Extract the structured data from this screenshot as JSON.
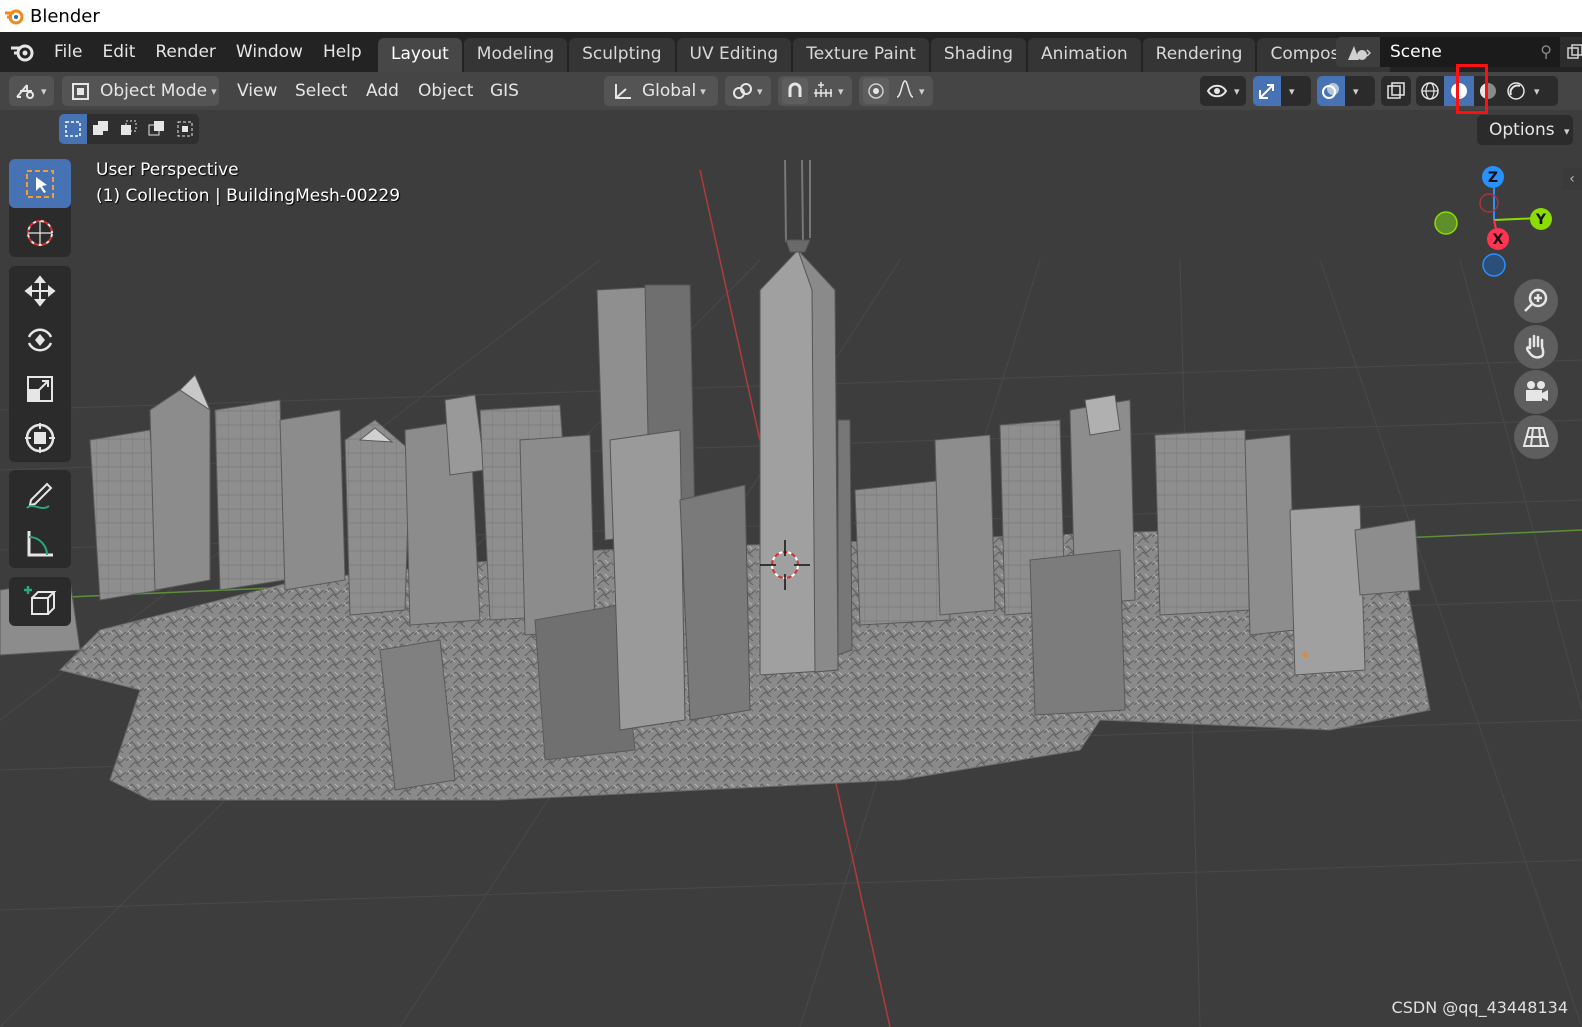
{
  "window": {
    "title": "Blender"
  },
  "menubar": {
    "items": [
      "File",
      "Edit",
      "Render",
      "Window",
      "Help"
    ]
  },
  "workspaces": {
    "tabs": [
      "Layout",
      "Modeling",
      "Sculpting",
      "UV Editing",
      "Texture Paint",
      "Shading",
      "Animation",
      "Rendering",
      "Compositing"
    ],
    "active": "Layout"
  },
  "scene": {
    "name": "Scene"
  },
  "viewport_header": {
    "mode": "Object Mode",
    "menus": [
      "View",
      "Select",
      "Add",
      "Object",
      "GIS"
    ],
    "transform_orientation": "Global",
    "options_label": "Options",
    "shading_active": "solid"
  },
  "viewport": {
    "view_name": "User Perspective",
    "collection_info": "(1) Collection | BuildingMesh-00229"
  },
  "gizmo": {
    "z_label": "Z",
    "y_label": "Y",
    "x_label": "X"
  },
  "colors": {
    "header_bg": "#454545",
    "viewport_bg": "#3d3d3d",
    "accent_blue": "#4772b3",
    "axis_x": "#ff3352",
    "axis_y": "#8bdc00",
    "axis_z": "#2890ff",
    "highlight": "#ff1010"
  },
  "watermark": "CSDN @qq_43448134"
}
